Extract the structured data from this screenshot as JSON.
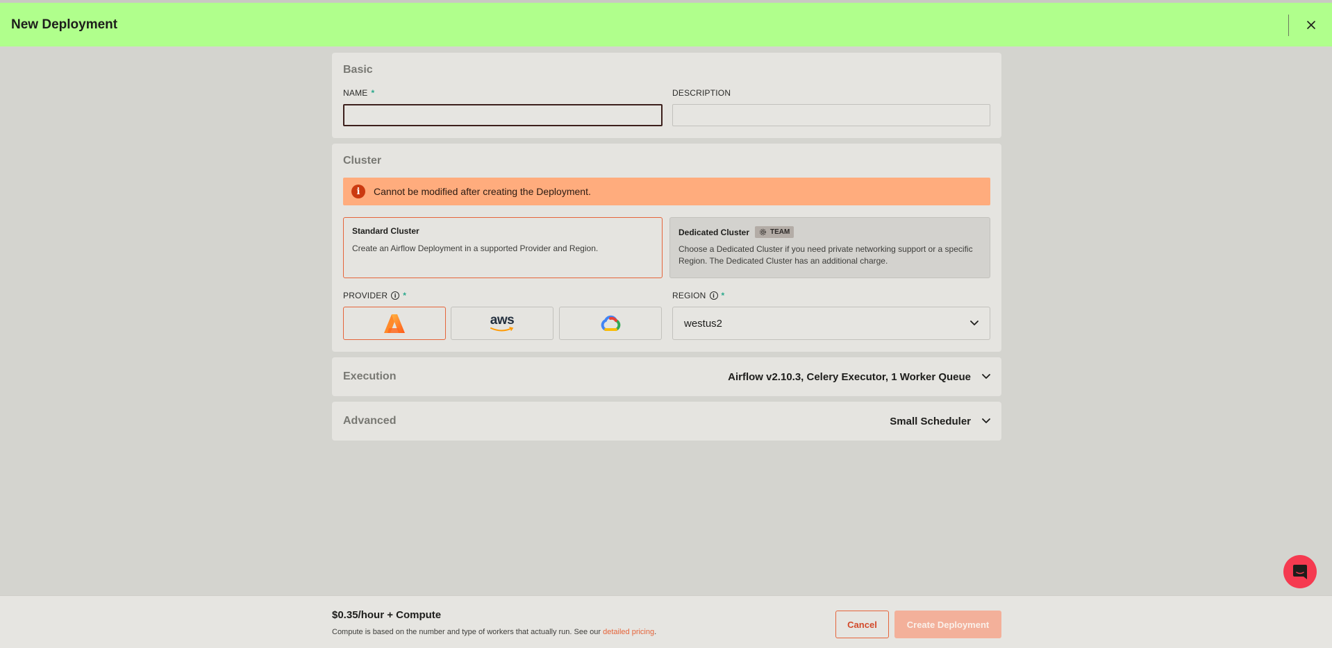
{
  "header": {
    "title": "New Deployment"
  },
  "basic": {
    "title": "Basic",
    "name_label": "NAME",
    "required_mark": "*",
    "name_value": "",
    "description_label": "DESCRIPTION",
    "description_value": ""
  },
  "cluster": {
    "title": "Cluster",
    "alert_text": "Cannot be modified after creating the Deployment.",
    "standard": {
      "title": "Standard Cluster",
      "description": "Create an Airflow Deployment in a supported Provider and Region."
    },
    "dedicated": {
      "title": "Dedicated Cluster",
      "badge": "TEAM",
      "description": "Choose a Dedicated Cluster if you need private networking support or a specific Region. The Dedicated Cluster has an additional charge."
    },
    "provider_label": "PROVIDER",
    "region_label": "REGION",
    "region_value": "westus2",
    "providers": [
      {
        "id": "azure",
        "icon": "azure-icon",
        "selected": true
      },
      {
        "id": "aws",
        "icon": "aws-icon",
        "label": "aws",
        "selected": false
      },
      {
        "id": "gcp",
        "icon": "gcp-icon",
        "selected": false
      }
    ]
  },
  "execution": {
    "title": "Execution",
    "summary": "Airflow v2.10.3, Celery Executor, 1 Worker Queue"
  },
  "advanced": {
    "title": "Advanced",
    "summary": "Small Scheduler"
  },
  "footer": {
    "price": "$0.35/hour + Compute",
    "note": "Compute is based on the number and type of workers that actually run. See our ",
    "link": "detailed pricing",
    "note_end": ".",
    "cancel_label": "Cancel",
    "create_label": "Create Deployment"
  },
  "colors": {
    "header_bg": "#b0ff8c",
    "accent": "#e5643a",
    "alert_bg": "#ffac7d",
    "chat_bg": "#f53a50"
  }
}
